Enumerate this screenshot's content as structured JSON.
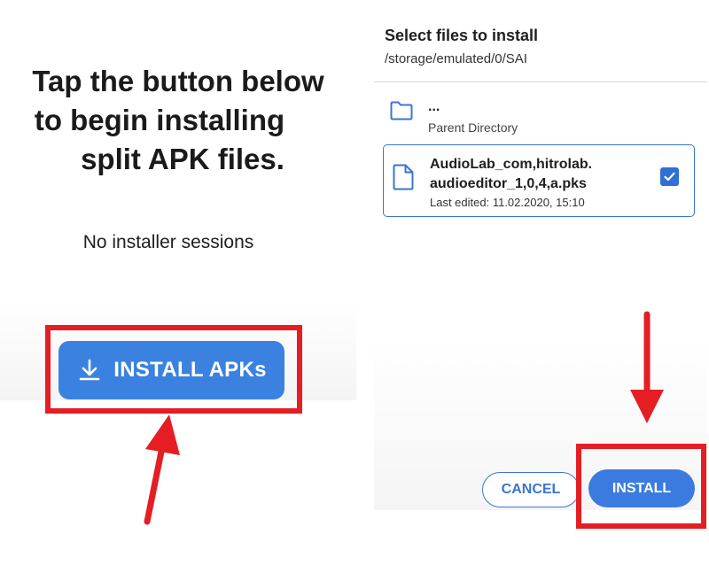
{
  "left": {
    "message_lines": [
      "Tap the button below",
      "to begin installing",
      "split APK files."
    ],
    "status_text": "No installer sessions",
    "install_button_label": "INSTALL APKs",
    "install_button_icon": "download-icon"
  },
  "dialog": {
    "title": "Select files to install",
    "path": "/storage/emulated/0/SAI",
    "parent": {
      "dots": "...",
      "label": "Parent Directory",
      "icon": "folder-icon"
    },
    "file": {
      "name_lines": [
        "AudioLab_com,hitrolab.",
        "audioeditor_1,0,4,a.pks"
      ],
      "last_edited": "Last edited: 11.02.2020, 15:10",
      "icon": "file-icon",
      "checked": true
    },
    "cancel_label": "CANCEL",
    "install_label": "INSTALL"
  },
  "colors": {
    "accent": "#3b82e0",
    "highlight": "#e41e23"
  }
}
